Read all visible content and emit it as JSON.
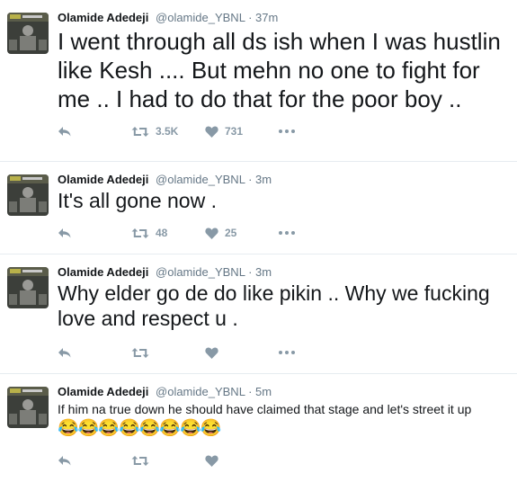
{
  "colors": {
    "name": "#14171a",
    "meta": "#657786",
    "icon": "#8899a6",
    "divider": "#e6ecf0"
  },
  "tweets": [
    {
      "name": "Olamide Adedeji",
      "handle": "@olamide_YBNL",
      "dot": "·",
      "time": "37m",
      "text": "I went through all ds ish when I was hustlin like Kesh .... But mehn no one to fight for me .. I had to do that for the poor boy ..",
      "retweets": "3.5K",
      "likes": "731"
    },
    {
      "name": "Olamide Adedeji",
      "handle": "@olamide_YBNL",
      "dot": "·",
      "time": "3m",
      "text": "It's all gone now .",
      "retweets": "48",
      "likes": "25"
    },
    {
      "name": "Olamide Adedeji",
      "handle": "@olamide_YBNL",
      "dot": "·",
      "time": "3m",
      "text": "Why elder go de do like pikin .. Why we fucking love and respect u .",
      "retweets": "",
      "likes": ""
    },
    {
      "name": "Olamide Adedeji",
      "handle": "@olamide_YBNL",
      "dot": "·",
      "time": "5m",
      "text": "If him na true down he should have claimed that stage and let's street it up",
      "emojis": "😂😂😂😂😂😂😂😂",
      "retweets": "",
      "likes": ""
    }
  ],
  "icons": [
    "reply-icon",
    "retweet-icon",
    "heart-icon",
    "more-icon"
  ]
}
